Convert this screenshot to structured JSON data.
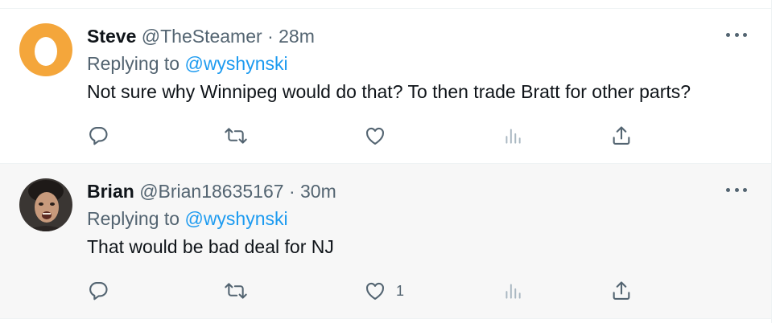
{
  "tweets": [
    {
      "name": "Steve",
      "handle": "@TheSteamer",
      "separator": "·",
      "time": "28m",
      "replying_prefix": "Replying to ",
      "replying_to": "@wyshynski",
      "text": "Not sure why Winnipeg would do that? To then trade Bratt for other parts?",
      "like_count": "",
      "avatar": "orange-egg-avatar",
      "accent": "#f4a63b"
    },
    {
      "name": "Brian",
      "handle": "@Brian18635167",
      "separator": "·",
      "time": "30m",
      "replying_prefix": "Replying to ",
      "replying_to": "@wyshynski",
      "text": "That would be bad deal for NJ",
      "like_count": "1",
      "avatar": "photo-avatar"
    }
  ],
  "colors": {
    "text": "#0f1419",
    "secondary": "#536471",
    "link": "#1d9bf0",
    "highlight_bg": "#f7f7f7"
  },
  "icons": [
    "reply-icon",
    "retweet-icon",
    "like-icon",
    "views-icon",
    "share-icon",
    "more-icon"
  ]
}
